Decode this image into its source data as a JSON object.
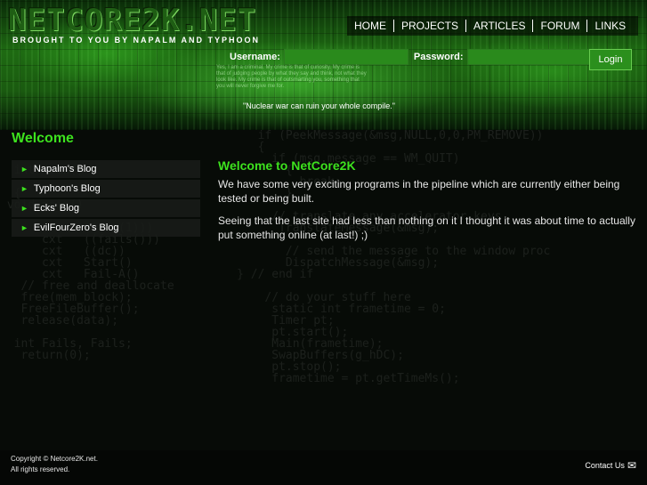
{
  "header": {
    "logo": "NETCORE2K.NET",
    "tagline": "BROUGHT TO YOU BY NAPALM AND TYPHOON",
    "quote": "\"Nuclear war can ruin your whole compile.\"",
    "manifesto": "Yes, I am a criminal. My crime is that of curiosity. My crime is that of judging people by what they say and think, not what they look like. My crime is that of outsmarting you, something that you will never forgive me for."
  },
  "nav": {
    "items": [
      {
        "label": "HOME"
      },
      {
        "label": "PROJECTS"
      },
      {
        "label": "ARTICLES"
      },
      {
        "label": "FORUM"
      },
      {
        "label": "LINKS"
      }
    ]
  },
  "login": {
    "username_label": "Username:",
    "password_label": "Password:",
    "button_label": "Login",
    "username_value": "",
    "password_value": ""
  },
  "page": {
    "title": "Welcome"
  },
  "sidebar": {
    "items": [
      {
        "label": "Napalm's Blog"
      },
      {
        "label": "Typhoon's Blog"
      },
      {
        "label": "Ecks' Blog"
      },
      {
        "label": "EvilFourZero's Blog"
      }
    ]
  },
  "article": {
    "heading": "Welcome to NetCore2K",
    "paragraphs": [
      "We have some very exciting programs in the pipeline which are currently either being tested or being built.",
      "Seeing that the last site had less than nothing on it I thought it was about time to actually put something online (at last!) ;)"
    ]
  },
  "background_code": "                                     if (PeekMessage(&msg,NULL,0,0,PM_REMOVE))\n                                     {\n                                       if (msg.message == WM_QUIT)\n  int main()                             {\n                                           break;\n  {                                      }\n void main()\n                                       // translate any accelerator keys\n      cxt   (((cx(1)))                  TranslateMessage(&msg);\n      cxt   ((fails()))\n      cxt   ((dc))                       // send the message to the window proc\n      cxt   Start()                      DispatchMessage(&msg);\n      cxt   Fail-A()              } // end if\n   // free and deallocate\n   free(mem_block);                   // do your stuff here\n   FreeFileBuffer();                   static int frametime = 0;\n   release(data);                      Timer pt;\n                                       pt.start();\n  int Fails, Fails;                    Main(frametime);\n   return(0);                          SwapBuffers(g_hDC);\n                                       pt.stop();\n                                       frametime = pt.getTimeMs();",
  "footer": {
    "copyright_line1": "Copyright © Netcore2K.net.",
    "copyright_line2": "All rights reserved.",
    "contact_label": "Contact Us"
  },
  "colors": {
    "accent_green": "#3de21e",
    "header_green": "#1e6a12",
    "background": "#070b07"
  }
}
